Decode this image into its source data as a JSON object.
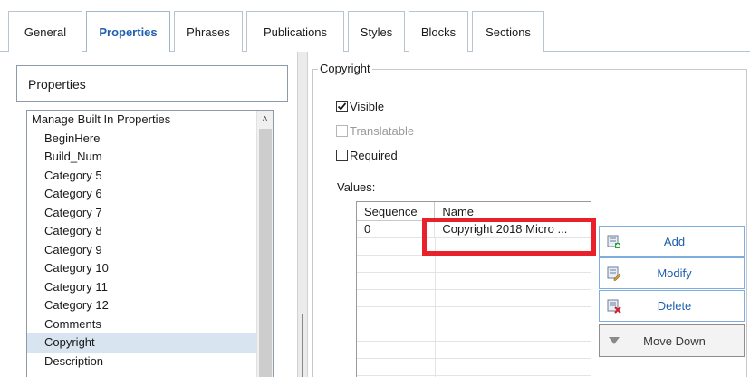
{
  "tabs": [
    {
      "label": "General",
      "active": false
    },
    {
      "label": "Properties",
      "active": true
    },
    {
      "label": "Phrases",
      "active": false
    },
    {
      "label": "Publications",
      "active": false
    },
    {
      "label": "Styles",
      "active": false
    },
    {
      "label": "Blocks",
      "active": false
    },
    {
      "label": "Sections",
      "active": false
    }
  ],
  "left": {
    "header": "Properties",
    "items": [
      "Manage Built In Properties",
      "BeginHere",
      "Build_Num",
      "Category 5",
      "Category 6",
      "Category 7",
      "Category 8",
      "Category 9",
      "Category 10",
      "Category 11",
      "Category 12",
      "Comments",
      "Copyright",
      "Description",
      ""
    ],
    "selected": "Copyright"
  },
  "right": {
    "group_title": "Copyright",
    "visible": {
      "label": "Visible",
      "checked": true
    },
    "translatable": {
      "label": "Translatable",
      "checked": false,
      "enabled": false
    },
    "required": {
      "label": "Required",
      "checked": false
    },
    "values_label": "Values:",
    "grid": {
      "columns": [
        "Sequence",
        "Name"
      ],
      "rows": [
        {
          "sequence": "0",
          "name": "Copyright 2018 Micro ..."
        }
      ]
    },
    "buttons": {
      "add": "Add",
      "modify": "Modify",
      "delete": "Delete",
      "move_down": "Move Down"
    }
  },
  "colors": {
    "accent": "#1f5fae",
    "highlight": "#e8212a",
    "selection": "#d9e4f1"
  }
}
